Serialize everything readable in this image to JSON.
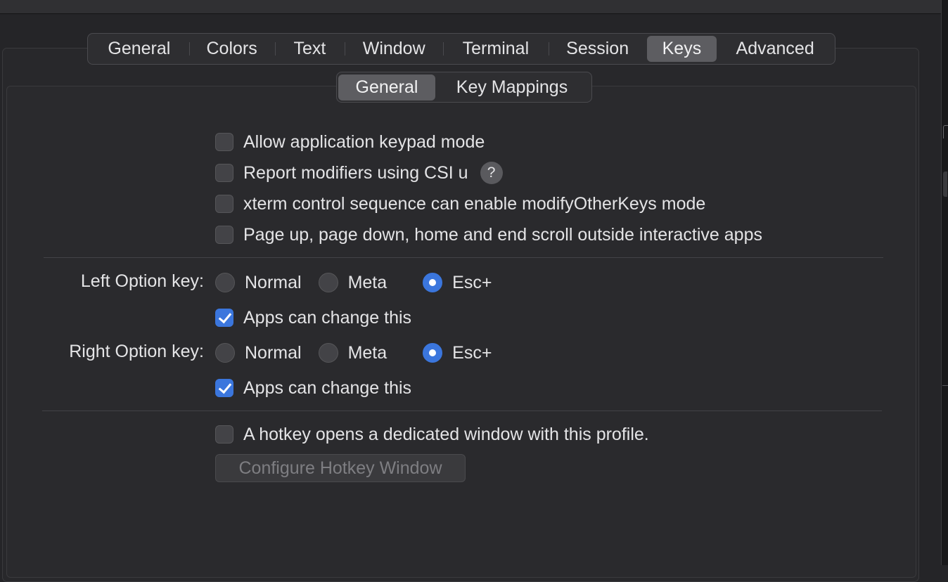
{
  "tabs": [
    {
      "label": "General",
      "selected": false
    },
    {
      "label": "Colors",
      "selected": false
    },
    {
      "label": "Text",
      "selected": false
    },
    {
      "label": "Window",
      "selected": false
    },
    {
      "label": "Terminal",
      "selected": false
    },
    {
      "label": "Session",
      "selected": false
    },
    {
      "label": "Keys",
      "selected": true
    },
    {
      "label": "Advanced",
      "selected": false
    }
  ],
  "subtabs": [
    {
      "label": "General",
      "selected": true
    },
    {
      "label": "Key Mappings",
      "selected": false
    }
  ],
  "options": [
    {
      "label": "Allow application keypad mode",
      "checked": false
    },
    {
      "label": "Report modifiers using CSI u",
      "checked": false,
      "help": "?"
    },
    {
      "label": "xterm control sequence can enable modifyOtherKeys mode",
      "checked": false
    },
    {
      "label": "Page up, page down, home and end scroll outside interactive apps",
      "checked": false
    }
  ],
  "left_option": {
    "label": "Left Option key:",
    "choices": [
      "Normal",
      "Meta",
      "Esc+"
    ],
    "selected": "Esc+",
    "apps_change_label": "Apps can change this",
    "apps_change_checked": true
  },
  "right_option": {
    "label": "Right Option key:",
    "choices": [
      "Normal",
      "Meta",
      "Esc+"
    ],
    "selected": "Esc+",
    "apps_change_label": "Apps can change this",
    "apps_change_checked": true
  },
  "hotkey": {
    "label": "A hotkey opens a dedicated window with this profile.",
    "checked": false,
    "button_label": "Configure Hotkey Window",
    "button_enabled": false
  },
  "colors": {
    "accent": "#3b76dd",
    "background": "#252528",
    "selected_tab": "#5d5d61"
  }
}
